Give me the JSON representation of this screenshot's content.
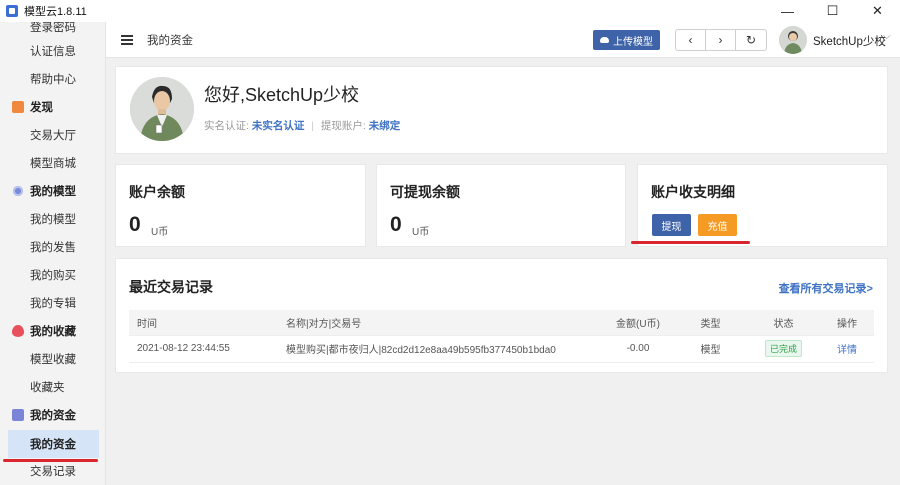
{
  "window": {
    "title": "模型云1.8.11",
    "controls": [
      "—",
      "☐",
      "✕"
    ]
  },
  "sidebar": {
    "items": [
      {
        "kind": "item",
        "label": "登录密码"
      },
      {
        "kind": "item",
        "label": "认证信息"
      },
      {
        "kind": "item",
        "label": "帮助中心"
      },
      {
        "kind": "head",
        "label": "发现",
        "icon": "discover-icon"
      },
      {
        "kind": "item",
        "label": "交易大厅"
      },
      {
        "kind": "item",
        "label": "模型商城"
      },
      {
        "kind": "head",
        "label": "我的模型",
        "icon": "model-icon"
      },
      {
        "kind": "item",
        "label": "我的模型"
      },
      {
        "kind": "item",
        "label": "我的发售"
      },
      {
        "kind": "item",
        "label": "我的购买"
      },
      {
        "kind": "item",
        "label": "我的专辑"
      },
      {
        "kind": "head",
        "label": "我的收藏",
        "icon": "favorites-icon"
      },
      {
        "kind": "item",
        "label": "模型收藏"
      },
      {
        "kind": "item",
        "label": "收藏夹"
      },
      {
        "kind": "head",
        "label": "我的资金",
        "icon": "wallet-icon"
      },
      {
        "kind": "item",
        "label": "我的资金",
        "active": true
      },
      {
        "kind": "item",
        "label": "交易记录"
      }
    ]
  },
  "header": {
    "page_title": "我的资金",
    "upload_label": "上传模型",
    "back_icon": "‹",
    "forward_icon": "›",
    "refresh_icon": "↻",
    "user_name": "SketchUp少校",
    "caret": "⌵"
  },
  "profile": {
    "greeting": "您好,SketchUp少校",
    "realname_label": "实名认证:",
    "realname_value": "未实名认证",
    "withdraw_account_label": "提现账户:",
    "withdraw_account_value": "未绑定"
  },
  "balance": {
    "account_title": "账户余额",
    "account_value": "0",
    "account_unit": "U币",
    "withdrawable_title": "可提现余额",
    "withdrawable_value": "0",
    "withdrawable_unit": "U币",
    "detail_title": "账户收支明细",
    "withdraw_btn": "提现",
    "recharge_btn": "充值"
  },
  "transactions": {
    "title": "最近交易记录",
    "view_all": "查看所有交易记录>",
    "columns": [
      "时间",
      "名称|对方|交易号",
      "金额(U币)",
      "类型",
      "状态",
      "操作"
    ],
    "rows": [
      {
        "time": "2021-08-12 23:44:55",
        "name": "模型购买|都市夜归人|82cd2d12e8aa49b595fb377450b1bda0",
        "amount": "-0.00",
        "type": "模型",
        "status": "已完成",
        "action": "详情"
      }
    ]
  },
  "colors": {
    "primary": "#3f63a9",
    "orange": "#f59a23",
    "link": "#3f73c4",
    "annotation": "#d9262e"
  }
}
